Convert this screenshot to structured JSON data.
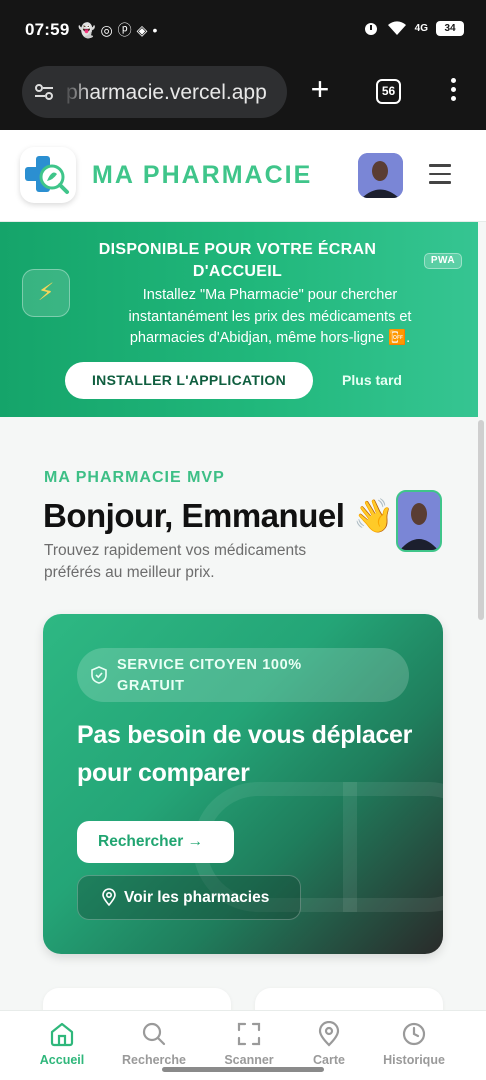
{
  "status_bar": {
    "time": "07:59",
    "battery": "34",
    "network": "4G"
  },
  "browser": {
    "url": "pharmacie.vercel.app",
    "tab_count": "56"
  },
  "header": {
    "brand": "MA PHARMACIE"
  },
  "pwa_banner": {
    "title": "DISPONIBLE POUR VOTRE ÉCRAN D'ACCUEIL",
    "badge": "PWA",
    "description": "Installez \"Ma Pharmacie\" pour chercher instantanément les prix des médicaments et pharmacies d'Abidjan, même hors-ligne 📴.",
    "install_label": "INSTALLER L'APPLICATION",
    "later_label": "Plus tard"
  },
  "main": {
    "eyebrow": "MA PHARMACIE MVP",
    "greeting": "Bonjour, Emmanuel 👋",
    "subtitle": "Trouvez rapidement vos médicaments préférés au meilleur prix."
  },
  "hero": {
    "chip": "SERVICE CITOYEN 100% GRATUIT",
    "title": "Pas besoin de vous déplacer pour comparer",
    "search_label": "Rechercher →",
    "pharmacies_label": "Voir les pharmacies"
  },
  "bottom_nav": {
    "items": [
      {
        "label": "Accueil",
        "icon": "home-icon",
        "active": true
      },
      {
        "label": "Recherche",
        "icon": "search-icon",
        "active": false
      },
      {
        "label": "Scanner",
        "icon": "scan-icon",
        "active": false
      },
      {
        "label": "Carte",
        "icon": "map-pin-icon",
        "active": false
      },
      {
        "label": "Historique",
        "icon": "history-icon",
        "active": false
      }
    ]
  },
  "colors": {
    "accent": "#3fc58a",
    "banner": "#21b87c",
    "dark": "#151515"
  }
}
